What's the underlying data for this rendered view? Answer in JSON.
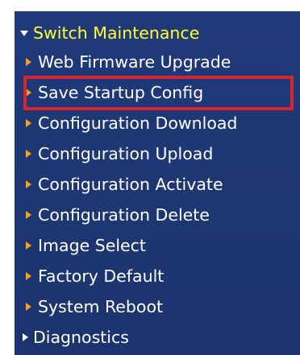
{
  "menu": {
    "header_label": "Switch Maintenance",
    "items": [
      {
        "label": "Web Firmware Upgrade"
      },
      {
        "label": "Save Startup Config"
      },
      {
        "label": "Configuration Download"
      },
      {
        "label": "Configuration Upload"
      },
      {
        "label": "Configuration Activate"
      },
      {
        "label": "Configuration Delete"
      },
      {
        "label": "Image Select"
      },
      {
        "label": "Factory Default"
      },
      {
        "label": "System Reboot"
      }
    ],
    "diagnostics_label": "Diagnostics"
  },
  "colors": {
    "panel_background": "#1f3a7a",
    "header_text": "#ffff33",
    "item_text": "#ffffff",
    "arrow_orange": "#f6a316",
    "highlight_border": "#d9232e"
  },
  "icons": {
    "header": "caret-down-icon",
    "item": "arrow-right-icon"
  }
}
